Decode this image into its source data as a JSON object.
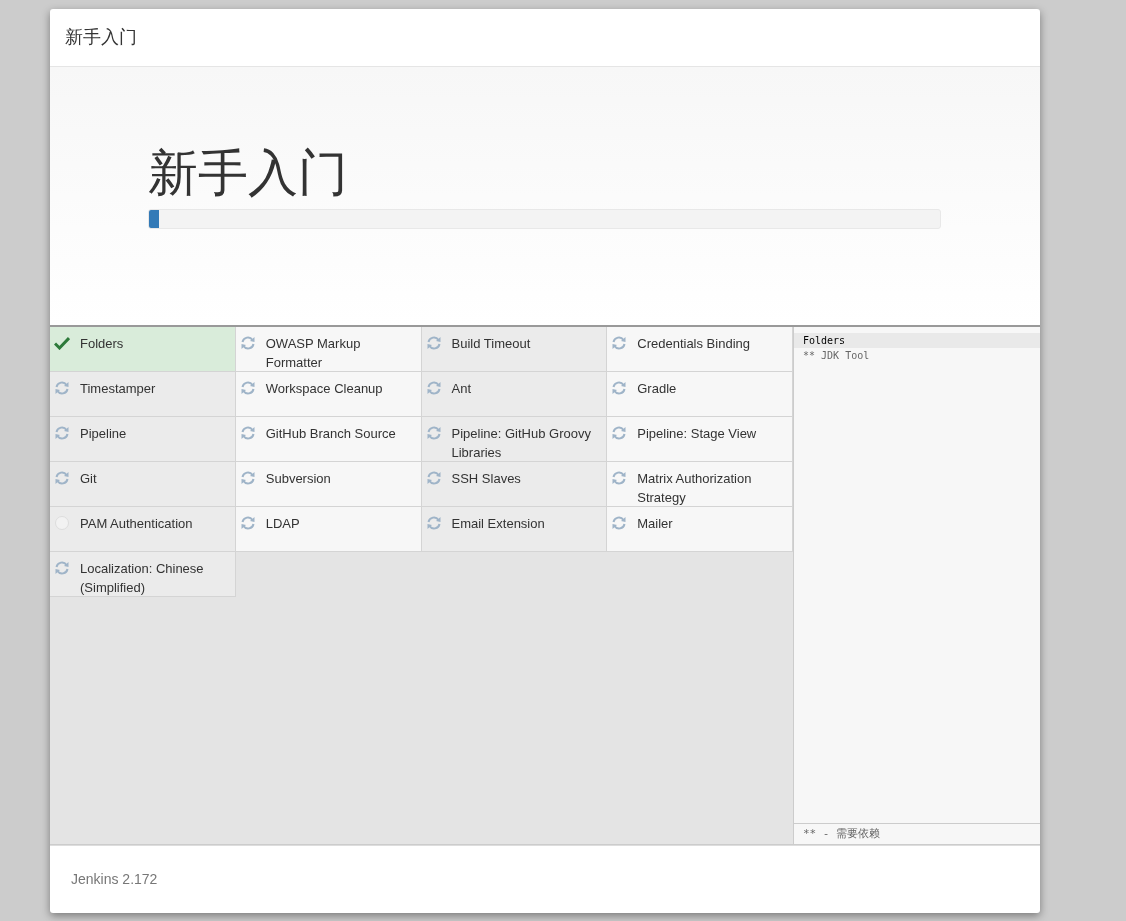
{
  "dialog": {
    "title": "新手入门"
  },
  "hero": {
    "heading": "新手入门",
    "progress": {
      "level": 0.013
    }
  },
  "plugins": [
    {
      "name": "Folders",
      "kind": "installed"
    },
    {
      "name": "OWASP Markup Formatter",
      "kind": "pending"
    },
    {
      "name": "Build Timeout",
      "kind": "pending"
    },
    {
      "name": "Credentials Binding",
      "kind": "pending"
    },
    {
      "name": "Timestamper",
      "kind": "pending"
    },
    {
      "name": "Workspace Cleanup",
      "kind": "pending"
    },
    {
      "name": "Ant",
      "kind": "pending"
    },
    {
      "name": "Gradle",
      "kind": "pending"
    },
    {
      "name": "Pipeline",
      "kind": "pending"
    },
    {
      "name": "GitHub Branch Source",
      "kind": "pending"
    },
    {
      "name": "Pipeline: GitHub Groovy Libraries",
      "kind": "pending"
    },
    {
      "name": "Pipeline: Stage View",
      "kind": "pending"
    },
    {
      "name": "Git",
      "kind": "pending"
    },
    {
      "name": "Subversion",
      "kind": "pending"
    },
    {
      "name": "SSH Slaves",
      "kind": "pending"
    },
    {
      "name": "Matrix Authorization Strategy",
      "kind": "pending"
    },
    {
      "name": "PAM Authentication",
      "kind": "none"
    },
    {
      "name": "LDAP",
      "kind": "pending"
    },
    {
      "name": "Email Extension",
      "kind": "pending"
    },
    {
      "name": "Mailer",
      "kind": "pending"
    },
    {
      "name": "Localization: Chinese (Simplified)",
      "kind": "pending"
    }
  ],
  "log": {
    "lines": [
      {
        "text": "Folders",
        "selected": true
      },
      {
        "text": "** JDK Tool",
        "selected": false
      }
    ],
    "legend": "** - 需要依赖"
  },
  "footer": {
    "version": "Jenkins 2.172"
  }
}
